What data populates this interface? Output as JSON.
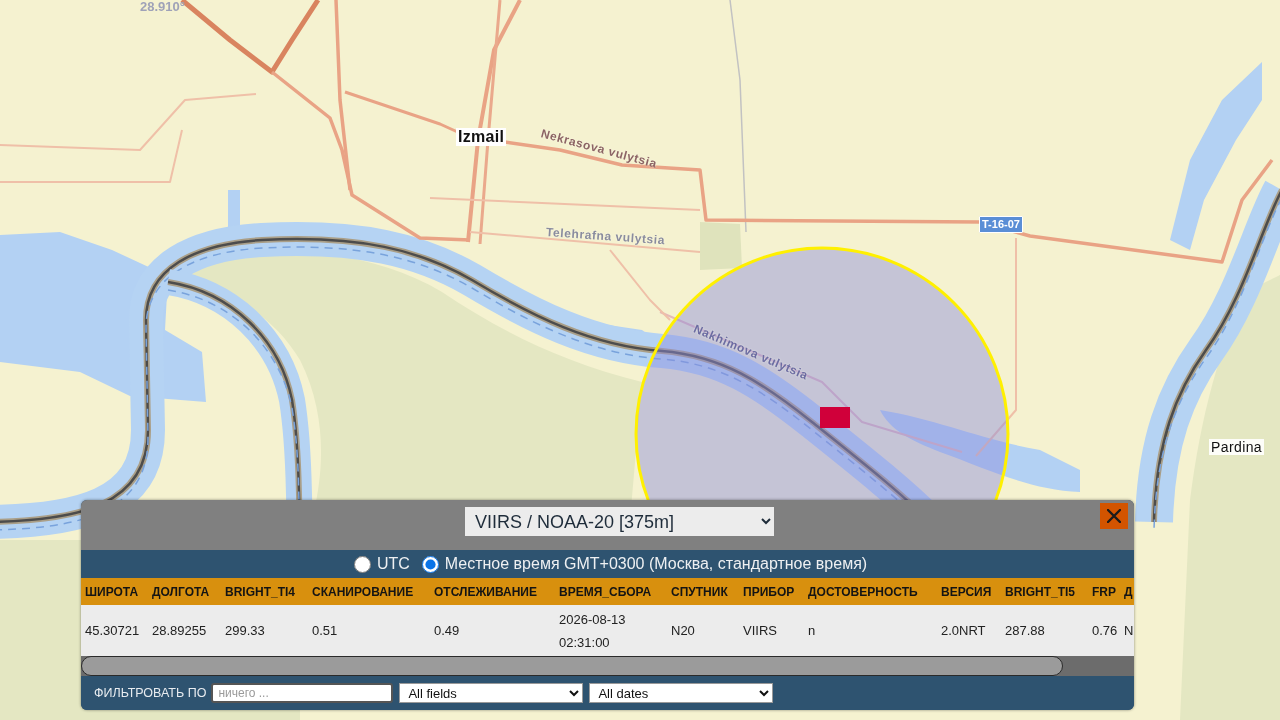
{
  "map": {
    "labels": [
      {
        "kind": "graticule",
        "text": "28.910°"
      },
      {
        "kind": "city",
        "text": "Izmail"
      },
      {
        "kind": "street",
        "text": "Nekrasova vulytsia"
      },
      {
        "kind": "street",
        "text": "Telehrafna vulytsia"
      },
      {
        "kind": "route",
        "text": "T-16-07"
      },
      {
        "kind": "street",
        "text": "Nakhimova vulytsia"
      },
      {
        "kind": "town",
        "text": "Pardina"
      }
    ]
  },
  "panel": {
    "product": "VIIRS / NOAA-20 [375m]",
    "time_modes": [
      {
        "label": "UTC",
        "selected": false
      },
      {
        "label": "Местное время GMT+0300 (Москва, стандартное время)",
        "selected": true
      }
    ],
    "table": {
      "columns": [
        "ШИРОТА",
        "ДОЛГОТА",
        "BRIGHT_TI4",
        "СКАНИРОВАНИЕ",
        "ОТСЛЕЖИВАНИЕ",
        "ВРЕМЯ_СБОРА",
        "СПУТНИК",
        "ПРИБОР",
        "ДОСТОВЕРНОСТЬ",
        "ВЕРСИЯ",
        "BRIGHT_TI5",
        "FRP",
        "Д"
      ],
      "rows": [
        [
          "45.30721",
          "28.89255",
          "299.33",
          "0.51",
          "0.49",
          "2026-08-13 02:31:00",
          "N20",
          "VIIRS",
          "n",
          "2.0NRT",
          "287.88",
          "0.76",
          "N"
        ]
      ]
    },
    "filter": {
      "label": "ФИЛЬТРОВАТЬ ПО",
      "search": {
        "placeholder": "ничего ..."
      },
      "fields": "All fields",
      "dates": "All dates"
    }
  }
}
